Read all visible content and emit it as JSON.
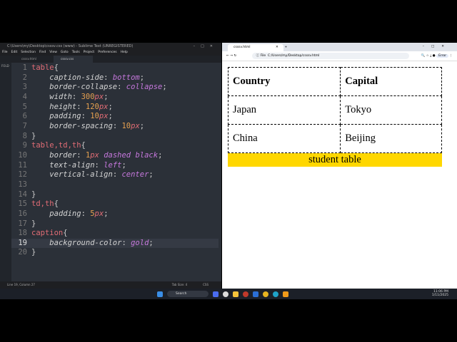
{
  "editor": {
    "title": "C:\\Users\\my\\Desktop\\csssv.css (www) - Sublime Text (UNREGISTERED)",
    "menu": [
      "File",
      "Edit",
      "Selection",
      "Find",
      "View",
      "Goto",
      "Tools",
      "Project",
      "Preferences",
      "Help"
    ],
    "tabs": [
      "csssv.html",
      "csssv.css"
    ],
    "sidebar_label": "FOLD",
    "status": {
      "position": "Line 19, Column 27",
      "tab_size": "Tab Size: 4",
      "syntax": "CSS"
    }
  },
  "browser": {
    "tab": "csssv.html",
    "url": "C:/Users/my/Desktop/csssv.html",
    "file_label": "File",
    "error_label": "Error"
  },
  "table": {
    "headers": [
      "Country",
      "Capital"
    ],
    "rows": [
      [
        "Japan",
        "Tokyo"
      ],
      [
        "China",
        "Beijing"
      ]
    ],
    "caption": "student table",
    "caption_color": "#ffd700"
  },
  "taskbar": {
    "search": "Search",
    "time": "11:06 PM",
    "date": "1/11/2025"
  }
}
